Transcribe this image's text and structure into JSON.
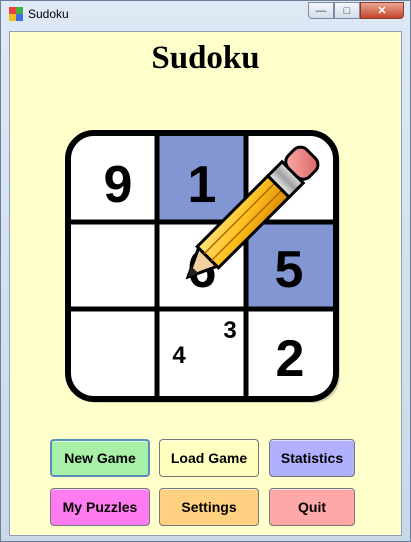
{
  "window": {
    "title": "Sudoku",
    "controls": {
      "minimize": "—",
      "maximize": "□",
      "close": "✕"
    }
  },
  "app": {
    "heading": "Sudoku"
  },
  "logo": {
    "cells": [
      "9",
      "1",
      "",
      "",
      "5",
      "3",
      "4",
      "2"
    ],
    "pencil_digit": "6"
  },
  "buttons": {
    "new_game": {
      "label": "New Game",
      "color": "#a8f0a8"
    },
    "load_game": {
      "label": "Load Game",
      "color": "#ffffc0"
    },
    "statistics": {
      "label": "Statistics",
      "color": "#b0b0ff"
    },
    "my_puzzles": {
      "label": "My Puzzles",
      "color": "#ff7cf0"
    },
    "settings": {
      "label": "Settings",
      "color": "#ffd080"
    },
    "quit": {
      "label": "Quit",
      "color": "#ffa8a8"
    }
  },
  "colors": {
    "highlight_cell": "#8196d2",
    "background": "#ffffcc"
  }
}
